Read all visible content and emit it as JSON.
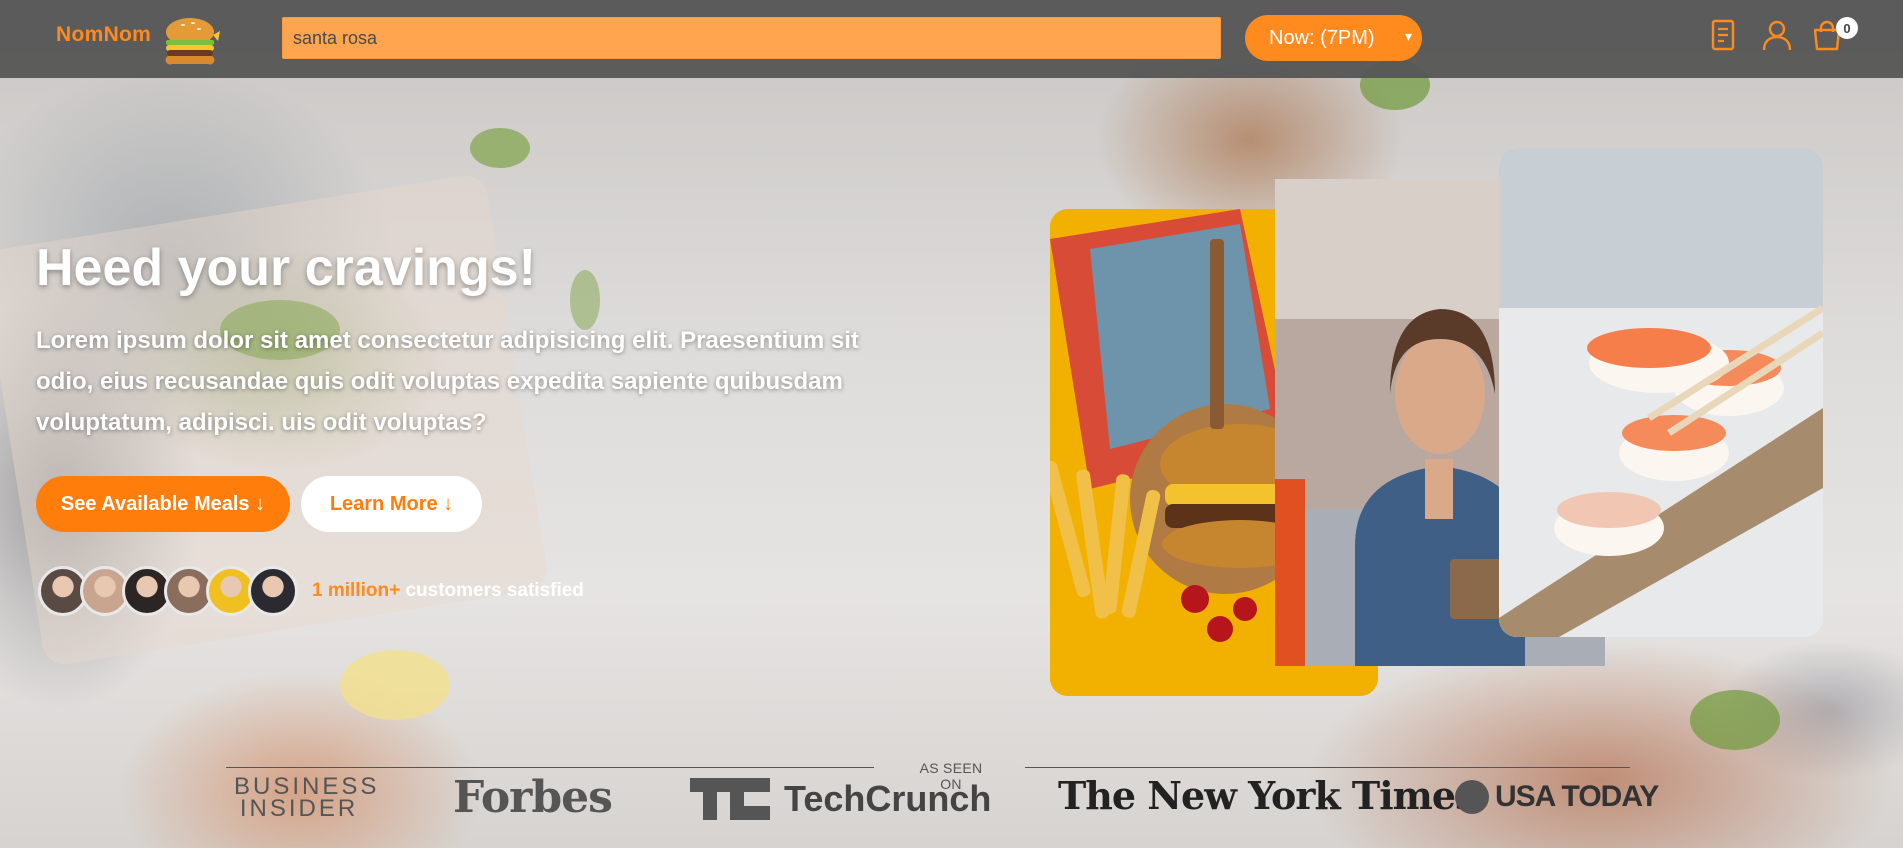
{
  "header": {
    "brand": "NomNom",
    "search_value": "santa rosa",
    "time_select": "Now: (7PM)",
    "cart_count": "0"
  },
  "hero": {
    "title": "Heed your cravings!",
    "text": "Lorem ipsum dolor sit amet consectetur adipisicing elit. Praesentium sit odio, eius recusandae quis odit voluptas expedita sapiente quibusdam voluptatum, adipisci. uis odit voluptas?",
    "primary_button": "See Available Meals ↓",
    "secondary_button": "Learn More ↓",
    "satisfied_highlight": "1 million+",
    "satisfied_text": " customers satisfied"
  },
  "avatars": [
    {
      "color": "#5a4a44"
    },
    {
      "color": "#c9a58f"
    },
    {
      "color": "#2b2624"
    },
    {
      "color": "#8a6d5c"
    },
    {
      "color": "#f0c020"
    },
    {
      "color": "#2a2a30"
    }
  ],
  "seen_on": {
    "label": "AS SEEN ON",
    "logos": [
      "BUSINESS INSIDER",
      "Forbes",
      "TechCrunch",
      "The New York Times",
      "USA TODAY"
    ]
  },
  "colors": {
    "accent": "#ff7d0a",
    "header_bg": "#555555"
  }
}
